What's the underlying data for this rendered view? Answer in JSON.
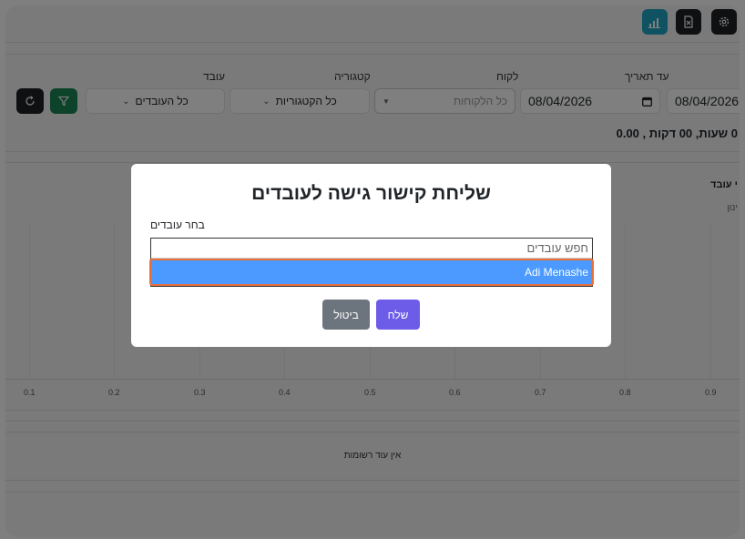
{
  "toolbar": {
    "chart_icon": "bar-chart-icon",
    "excel_icon": "excel-file-icon",
    "settings_icon": "gear-icon"
  },
  "filters": {
    "date_to_label": "עד תאריך",
    "date_from_value": "08/04/2026",
    "date_to_value": "08/04/2026",
    "customer_label": "לקוח",
    "customer_placeholder": "כל הלקוחות",
    "category_label": "קטגוריה",
    "category_value": "כל הקטגוריות",
    "employee_label": "עובד",
    "employee_value": "כל העובדים"
  },
  "summary": {
    "total_text": "0 שעות, 00 דקות , 0.00"
  },
  "chart": {
    "title_partial": "י עובד",
    "subtitle_partial": "ינון",
    "ticks": [
      "0.1",
      "0.2",
      "0.3",
      "0.4",
      "0.5",
      "0.6",
      "0.7",
      "0.8",
      "0.9"
    ]
  },
  "records": {
    "empty_text": "אין עוד רשומות"
  },
  "modal": {
    "title": "שליחת קישור גישה לעובדים",
    "select_label": "בחר עובדים",
    "search_placeholder": "חפש עובדים",
    "options": [
      "Adi Menashe"
    ],
    "send_label": "שלח",
    "cancel_label": "ביטול"
  },
  "colors": {
    "chart_button": "#1ea7c4",
    "filter_button": "#198754",
    "send_button": "#6c5ce7",
    "cancel_button": "#6c757d",
    "selected_option": "#4c9aff",
    "option_border": "#e8703a"
  }
}
